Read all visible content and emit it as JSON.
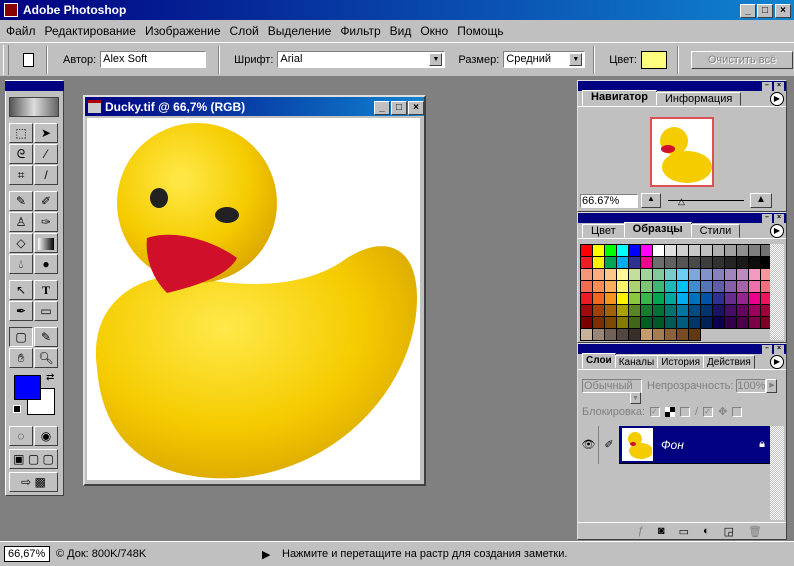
{
  "app": {
    "title": "Adobe Photoshop",
    "icon": "photoshop-eye-icon"
  },
  "menu": [
    "Файл",
    "Редактирование",
    "Изображение",
    "Слой",
    "Выделение",
    "Фильтр",
    "Вид",
    "Окно",
    "Помощь"
  ],
  "options": {
    "author_label": "Автор:",
    "author_value": "Alex Soft",
    "font_label": "Шрифт:",
    "font_value": "Arial",
    "size_label": "Размер:",
    "size_value": "Средний",
    "color_label": "Цвет:",
    "color_value": "#ffff80",
    "clear_label": "Очистить всё"
  },
  "document": {
    "title": "Ducky.tif @ 66,7% (RGB)"
  },
  "toolbox": {
    "foreground": "#0000ff",
    "background": "#ffffff"
  },
  "navigator": {
    "tabs": [
      "Навигатор",
      "Информация"
    ],
    "zoom": "66.67%"
  },
  "swatches": {
    "tabs": [
      "Цвет",
      "Образцы",
      "Стили"
    ],
    "rows": [
      [
        "#ff0000",
        "#ffff00",
        "#00ff00",
        "#00ffff",
        "#0000ff",
        "#ff00ff",
        "#ffffff",
        "#e0e0e0",
        "#d0d0d0",
        "#c8c8c8",
        "#c0c0c0",
        "#b0b0b0",
        "#a0a0a0",
        "#909090",
        "#808080",
        "#707070"
      ],
      [
        "#ee1c24",
        "#fff200",
        "#00a651",
        "#00aeef",
        "#2e3192",
        "#ec008c",
        "#6d6d6d",
        "#616161",
        "#555555",
        "#494949",
        "#3d3d3d",
        "#313131",
        "#252525",
        "#191919",
        "#0d0d0d",
        "#000000"
      ],
      [
        "#f69679",
        "#f9ad81",
        "#fdc68a",
        "#fff799",
        "#c4df9b",
        "#a3d39c",
        "#82ca9c",
        "#7accc8",
        "#6dcff6",
        "#7da7d9",
        "#8393ca",
        "#8781bd",
        "#a186be",
        "#bd8cbf",
        "#f49ac1",
        "#f5989d"
      ],
      [
        "#f26c4f",
        "#f68e55",
        "#fbaf5c",
        "#fff467",
        "#acd372",
        "#7cc576",
        "#3bb878",
        "#1abbb4",
        "#00bff3",
        "#438ccb",
        "#5574b9",
        "#605ca8",
        "#855fa8",
        "#a763a8",
        "#f06ea9",
        "#f26d7d"
      ],
      [
        "#ed1c24",
        "#f26522",
        "#f7941d",
        "#fff200",
        "#8dc73f",
        "#39b54a",
        "#00a651",
        "#00a99d",
        "#00aeef",
        "#0072bc",
        "#0054a6",
        "#2e3192",
        "#662d91",
        "#92278f",
        "#ec008c",
        "#ed145b"
      ],
      [
        "#9e0b0f",
        "#a0410d",
        "#a36209",
        "#aba000",
        "#598527",
        "#197b30",
        "#007236",
        "#00746b",
        "#0076a3",
        "#004b80",
        "#003471",
        "#1b1464",
        "#440e62",
        "#630460",
        "#9e005d",
        "#9e0039"
      ],
      [
        "#790000",
        "#7b2e00",
        "#7d4900",
        "#827b00",
        "#406618",
        "#005e20",
        "#005826",
        "#005952",
        "#005b7f",
        "#003663",
        "#002157",
        "#0d004c",
        "#32004b",
        "#4b0049",
        "#7b0046",
        "#7a0026"
      ],
      [
        "#c7b299",
        "#998675",
        "#736357",
        "#534741",
        "#37302a",
        "#c69c6d",
        "#a67c52",
        "#8c6239",
        "#754c24",
        "#603913"
      ]
    ]
  },
  "layers": {
    "tabs": [
      "Слои",
      "Каналы",
      "История",
      "Действия"
    ],
    "tab_partials": [
      "Слои",
      "алы",
      "ория",
      "ствия"
    ],
    "blend": "Обычный",
    "blend_shown": "Обыч",
    "opacity_label": "Непрозрачность:",
    "opacity": "100%",
    "lock_label": "Блокировка:",
    "layer_name": "Фон"
  },
  "status": {
    "zoom": "66,67%",
    "doc": "© Док: 800K/748K",
    "hint": "Нажмите и перетащите на растр для создания заметки."
  }
}
